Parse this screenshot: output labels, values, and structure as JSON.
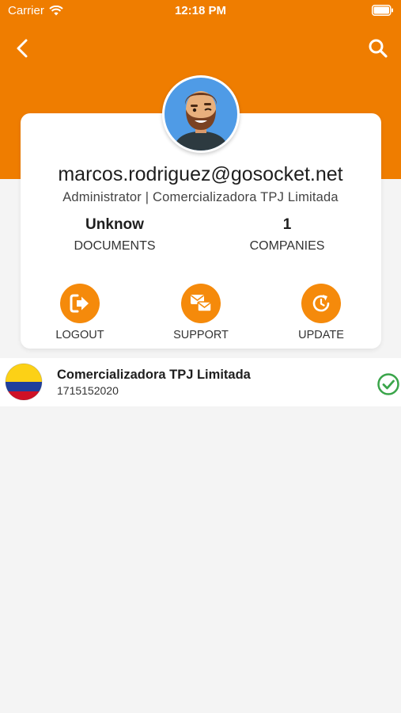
{
  "status_bar": {
    "carrier": "Carrier",
    "time": "12:18 PM"
  },
  "colors": {
    "accent": "#ef7d00",
    "button": "#f58a0b",
    "success": "#3aa54a",
    "background": "#f4f4f4"
  },
  "profile": {
    "email": "marcos.rodriguez@gosocket.net",
    "role": "Administrator | Comercializadora TPJ Limitada",
    "stats": [
      {
        "value": "Unknow",
        "label": "DOCUMENTS"
      },
      {
        "value": "1",
        "label": "COMPANIES"
      }
    ],
    "actions": [
      {
        "label": "LOGOUT",
        "icon": "logout-icon"
      },
      {
        "label": "SUPPORT",
        "icon": "support-icon"
      },
      {
        "label": "UPDATE",
        "icon": "update-icon"
      }
    ]
  },
  "companies": [
    {
      "name": "Comercializadora TPJ Limitada",
      "id": "1715152020",
      "flag": "colombia-flag-icon",
      "selected": true
    }
  ]
}
